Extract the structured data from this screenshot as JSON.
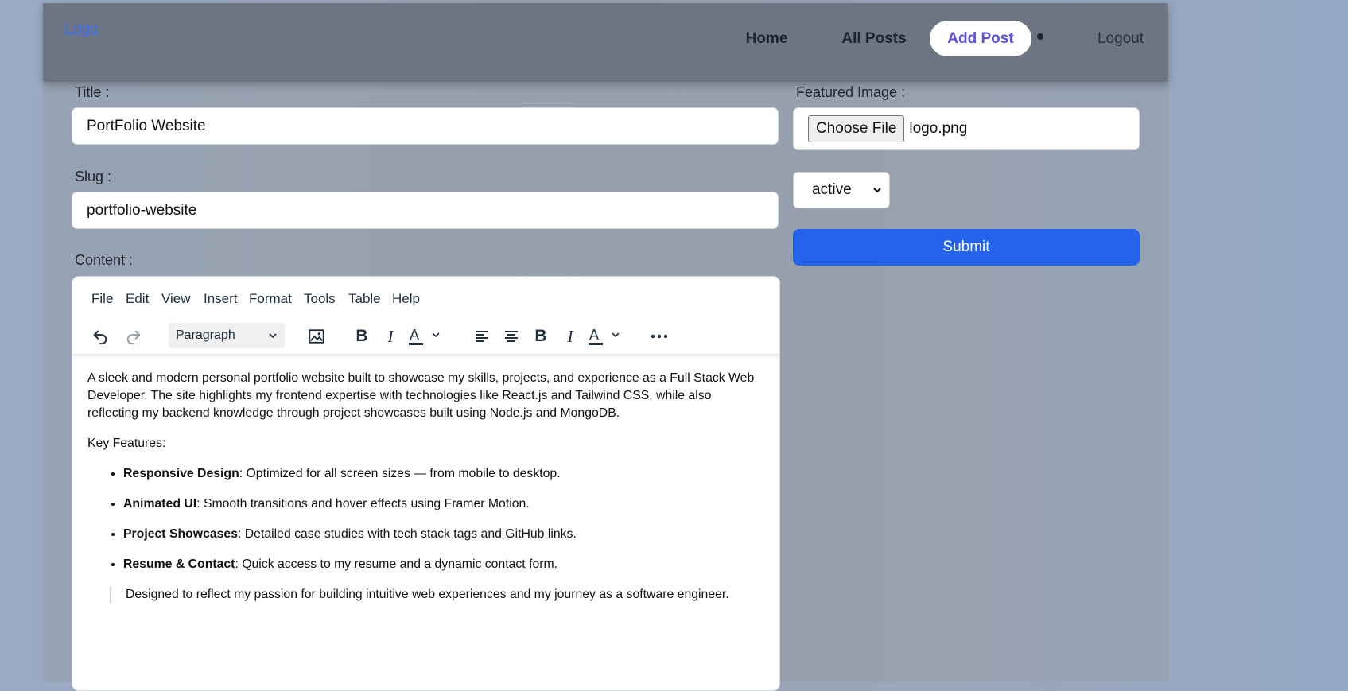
{
  "nav": {
    "logo": "Logo",
    "items": [
      {
        "label": "Home"
      },
      {
        "label": "All Posts"
      },
      {
        "label": "Add Post",
        "active": true
      },
      {
        "label": "Logout"
      }
    ]
  },
  "form": {
    "title_label": "Title :",
    "title_value": "PortFolio Website",
    "slug_label": "Slug :",
    "slug_value": "portfolio-website",
    "content_label": "Content :",
    "image_label": "Featured Image :",
    "choose_file_label": "Choose File",
    "file_name": "logo.png",
    "status_value": "active",
    "submit_label": "Submit"
  },
  "editor": {
    "menu": [
      "File",
      "Edit",
      "View",
      "Insert",
      "Format",
      "Tools",
      "Table",
      "Help"
    ],
    "block_format": "Paragraph",
    "toolbar_icons": [
      "undo-icon",
      "redo-icon",
      "image-icon",
      "bold-icon",
      "italic-icon",
      "text-color-icon",
      "align-left-icon",
      "align-center-icon",
      "bold-icon",
      "italic-icon",
      "text-color-icon",
      "more-icon"
    ],
    "intro": "A sleek and modern personal portfolio website built to showcase my skills, projects, and experience as a Full Stack Web Developer. The site highlights my frontend expertise with technologies like React.js and Tailwind CSS, while also reflecting my backend knowledge through project showcases built using Node.js and MongoDB.",
    "features_heading": "Key Features:",
    "features": [
      {
        "title": "Responsive Design",
        "text": ": Optimized for all screen sizes — from mobile to desktop."
      },
      {
        "title": "Animated UI",
        "text": ": Smooth transitions and hover effects using Framer Motion."
      },
      {
        "title": "Project Showcases",
        "text": ": Detailed case studies with tech stack tags and GitHub links."
      },
      {
        "title": "Resume & Contact",
        "text": ": Quick access to my resume and a dynamic contact form."
      }
    ],
    "quote": "Designed to reflect my passion for building intuitive web experiences and my journey as a software engineer."
  },
  "colors": {
    "accent": "#2563eb",
    "nav_active_text": "#5b50e0",
    "navbar_bg": "#6d7482"
  }
}
